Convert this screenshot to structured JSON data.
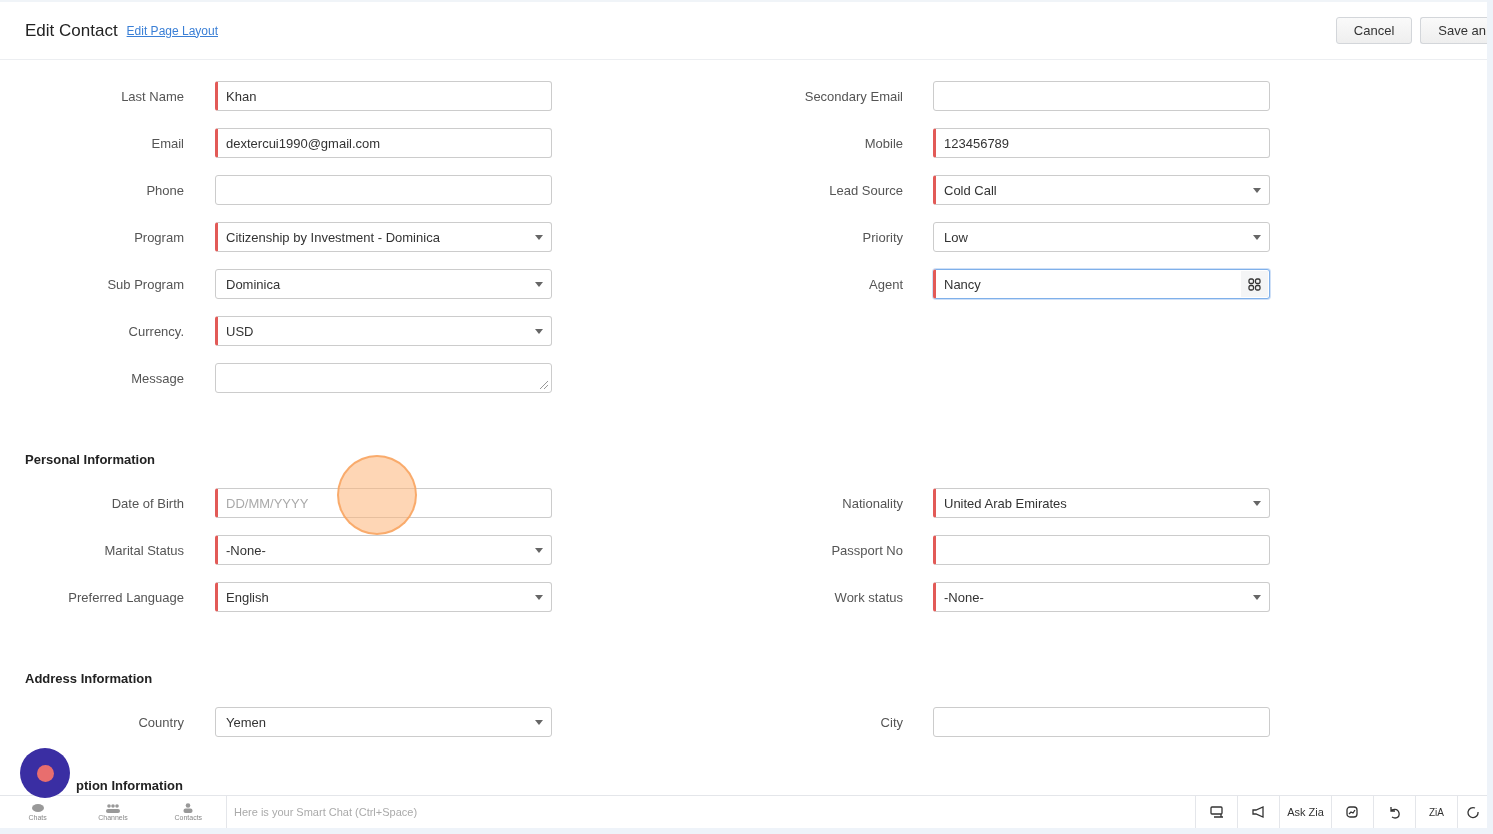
{
  "header": {
    "title": "Edit Contact",
    "layout_link": "Edit Page Layout",
    "buttons": [
      "Cancel",
      "Save an"
    ]
  },
  "sections": [
    {
      "rows": [
        {
          "left": {
            "label": "Last Name",
            "kind": "text",
            "value": "Khan",
            "mandatory": true,
            "focused": false
          },
          "right": {
            "label": "Secondary Email",
            "kind": "text",
            "mandatory": false,
            "focused": false
          }
        },
        {
          "left": {
            "label": "Email",
            "kind": "text",
            "value": "dextercui1990@gmail.com",
            "mandatory": true,
            "focused": false
          },
          "right": {
            "label": "Mobile",
            "kind": "text",
            "value": "123456789",
            "mandatory": true,
            "focused": false
          }
        },
        {
          "left": {
            "label": "Phone",
            "kind": "text",
            "mandatory": false,
            "focused": false
          },
          "right": {
            "label": "Lead Source",
            "kind": "select",
            "value": "Cold Call",
            "mandatory": true,
            "focused": false
          }
        },
        {
          "left": {
            "label": "Program",
            "kind": "select",
            "value": "Citizenship by Investment - Dominica",
            "mandatory": true,
            "focused": false
          },
          "right": {
            "label": "Priority",
            "kind": "select",
            "value": "Low",
            "mandatory": false,
            "focused": false
          }
        },
        {
          "left": {
            "label": "Sub Program",
            "kind": "select",
            "value": "Dominica",
            "mandatory": false,
            "focused": false
          },
          "right": {
            "label": "Agent",
            "kind": "lookup",
            "value": "Nancy",
            "mandatory": true,
            "focused": true
          }
        },
        {
          "left": {
            "label": "Currency.",
            "kind": "select",
            "value": "USD",
            "mandatory": true,
            "focused": false
          }
        },
        {
          "left": {
            "label": "Message",
            "kind": "textarea",
            "mandatory": false,
            "focused": false
          }
        }
      ]
    },
    {
      "title": "Personal Information",
      "rows": [
        {
          "left": {
            "label": "Date of Birth",
            "kind": "date",
            "placeholder": "DD/MM/YYYY",
            "mandatory": true,
            "focused": false
          },
          "right": {
            "label": "Nationality",
            "kind": "select",
            "value": "United Arab Emirates",
            "mandatory": true,
            "focused": false
          }
        },
        {
          "left": {
            "label": "Marital Status",
            "kind": "select",
            "value": "-None-",
            "mandatory": true,
            "focused": false
          },
          "right": {
            "label": "Passport No",
            "kind": "text",
            "mandatory": true,
            "focused": false
          }
        },
        {
          "left": {
            "label": "Preferred Language",
            "kind": "select",
            "value": "English",
            "mandatory": true,
            "focused": false
          },
          "right": {
            "label": "Work status",
            "kind": "select",
            "value": "-None-",
            "mandatory": true,
            "focused": false
          }
        }
      ]
    },
    {
      "title": "Address Information",
      "rows": [
        {
          "left": {
            "label": "Country",
            "kind": "select",
            "value": "Yemen",
            "mandatory": false,
            "focused": false
          },
          "right": {
            "label": "City",
            "kind": "text",
            "mandatory": false,
            "focused": false
          }
        }
      ]
    },
    {
      "title": "ption Information"
    }
  ],
  "bottom_bar": {
    "tabs": [
      {
        "label": "Chats",
        "kind": "chat"
      },
      {
        "label": "Channels",
        "kind": "group"
      },
      {
        "label": "Contacts",
        "kind": "person"
      }
    ],
    "chat_placeholder": "Here is your Smart Chat (Ctrl+Space)",
    "ask_zia": "Ask Zia",
    "zia_logo": "ZiA"
  }
}
